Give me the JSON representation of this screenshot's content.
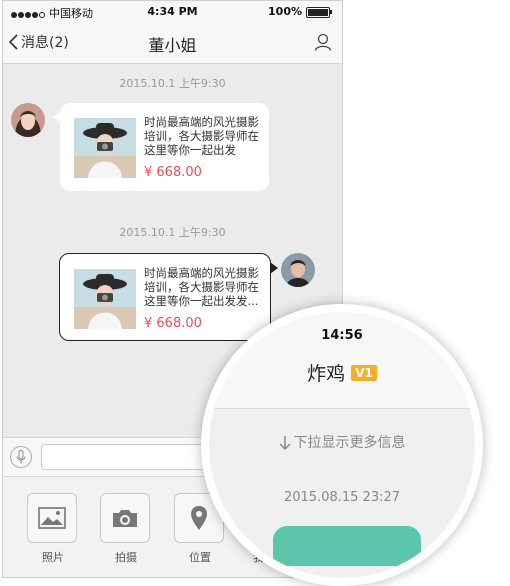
{
  "status": {
    "carrier": "中国移动",
    "time": "4:34 PM",
    "battery": "100%"
  },
  "nav": {
    "back_label": "消息(2)",
    "title": "董小姐"
  },
  "messages": [
    {
      "timestamp": "2015.10.1  上午9:30",
      "text": "时尚最高端的风光摄影培训，各大摄影导师在这里等你一起出发",
      "price": "¥ 668.00"
    },
    {
      "timestamp": "2015.10.1  上午9:30",
      "text": "时尚最高端的风光摄影培训，各大摄影导师在这里等你一起出发发...",
      "price": "¥ 668.00"
    }
  ],
  "tools": [
    {
      "label": "照片",
      "icon": "image-icon"
    },
    {
      "label": "拍摄",
      "icon": "camera-icon"
    },
    {
      "label": "位置",
      "icon": "location-pin-icon"
    },
    {
      "label": "我的服务",
      "icon": "service-icon"
    }
  ],
  "magnifier": {
    "time": "14:56",
    "title": "炸鸡",
    "badge": "V1",
    "pull_hint": "下拉显示更多信息",
    "date": "2015.08.15 23:27"
  },
  "colors": {
    "price": "#e84d5b",
    "badge": "#f3b022",
    "accent": "#5cc6ab"
  }
}
